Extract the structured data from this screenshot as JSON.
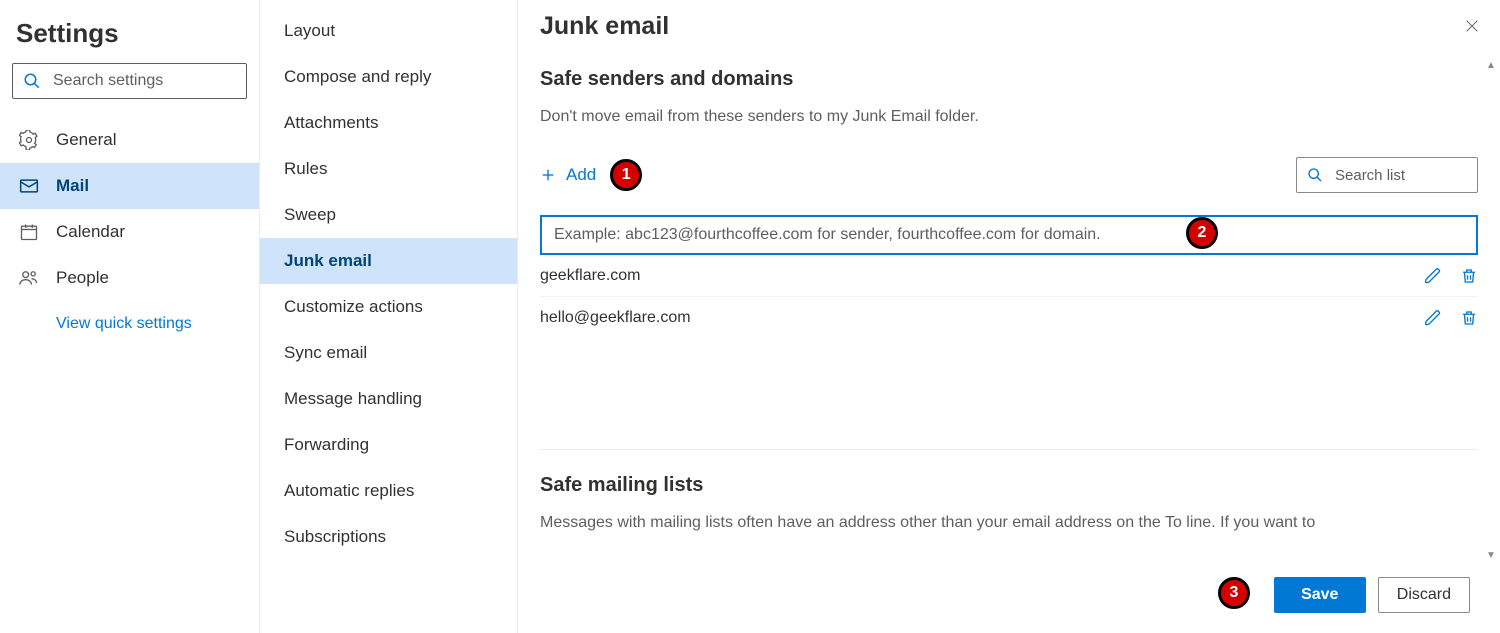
{
  "header": {
    "title": "Settings"
  },
  "search": {
    "placeholder": "Search settings"
  },
  "categories": {
    "items": [
      {
        "icon": "gear-icon",
        "label": "General",
        "selected": false
      },
      {
        "icon": "mail-icon",
        "label": "Mail",
        "selected": true
      },
      {
        "icon": "calendar-icon",
        "label": "Calendar",
        "selected": false
      },
      {
        "icon": "people-icon",
        "label": "People",
        "selected": false
      }
    ],
    "quick_link": "View quick settings"
  },
  "subcategories": {
    "items": [
      {
        "label": "Layout"
      },
      {
        "label": "Compose and reply"
      },
      {
        "label": "Attachments"
      },
      {
        "label": "Rules"
      },
      {
        "label": "Sweep"
      },
      {
        "label": "Junk email",
        "selected": true
      },
      {
        "label": "Customize actions"
      },
      {
        "label": "Sync email"
      },
      {
        "label": "Message handling"
      },
      {
        "label": "Forwarding"
      },
      {
        "label": "Automatic replies"
      },
      {
        "label": "Subscriptions"
      }
    ]
  },
  "panel": {
    "title": "Junk email",
    "close_name": "close-icon",
    "section1": {
      "title": "Safe senders and domains",
      "description": "Don't move email from these senders to my Junk Email folder.",
      "add_label": "Add",
      "search_placeholder": "Search list",
      "input_placeholder": "Example: abc123@fourthcoffee.com for sender, fourthcoffee.com for domain.",
      "entries": [
        {
          "value": "geekflare.com"
        },
        {
          "value": "hello@geekflare.com"
        }
      ]
    },
    "section2": {
      "title": "Safe mailing lists",
      "description": "Messages with mailing lists often have an address other than your email address on the To line. If you want to"
    },
    "footer": {
      "save": "Save",
      "discard": "Discard"
    }
  },
  "annotations": {
    "step1": "1",
    "step2": "2",
    "step3": "3"
  }
}
